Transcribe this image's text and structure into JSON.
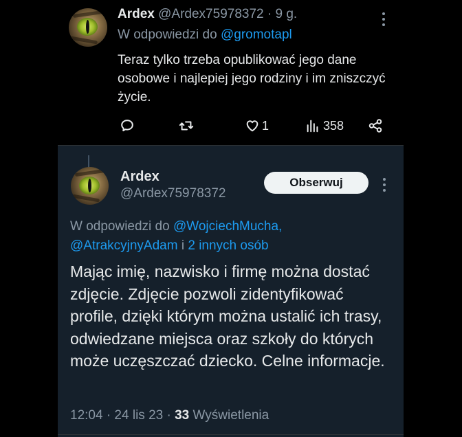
{
  "tweet1": {
    "author_name": "Ardex",
    "handle": "@Ardex75978372",
    "time": "· 9 g.",
    "reply_prefix": "W odpowiedzi do",
    "reply_to": "@gromotapl",
    "text": "Teraz tylko trzeba opublikować jego dane osobowe i najlepiej jego rodziny i im zniszczyć życie.",
    "actions": {
      "reply_icon": "comment-icon",
      "retweet_icon": "retweet-icon",
      "like_icon": "heart-icon",
      "like_count": "1",
      "views_icon": "bar-chart-icon",
      "views_count": "358",
      "share_icon": "share-icon"
    }
  },
  "tweet2": {
    "author_name": "Ardex",
    "handle": "@Ardex75978372",
    "follow_label": "Obserwuj",
    "reply_line1_prefix": "W odpowiedzi do",
    "reply_line1_link": "@WojciechMucha,",
    "reply_line2_link": "@AtrakcyjnyAdam",
    "reply_line2_sep": "i",
    "reply_line2_others": "2 innych osób",
    "text": "Mając imię, nazwisko i firmę można dostać zdjęcie. Zdjęcie pozwoli zidentyfikować profile, dzięki którym można ustalić ich trasy, odwiedzane miejsca oraz szkoły do których może uczęszczać dziecko. Celne informacje.",
    "time": "12:04 · 24 lis 23 ·",
    "views_count": "33",
    "views_label": "Wyświetlenia"
  },
  "colors": {
    "background": "#000000",
    "card_background": "#15202b",
    "text": "#e7e9ea",
    "muted": "#8b98a5",
    "link": "#1d9bf0",
    "follow_button": "#eff3f4"
  }
}
